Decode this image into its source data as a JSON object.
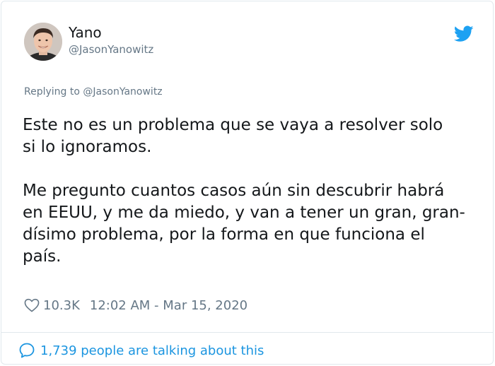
{
  "author": {
    "display_name": "Yano",
    "handle": "@JasonYanowitz"
  },
  "reply": {
    "prefix": "Replying to ",
    "handle": "@JasonYanowitz"
  },
  "tweet": {
    "paragraphs": [
      "Este no es un problema que se vaya a resolver solo\nsi lo ignoramos.",
      "Me pregunto cuantos casos aún sin descubrir habrá\nen EEUU, y me da miedo, y van a tener un gran, gran-\ndísimo problema, por la forma en que funciona el\npaís."
    ]
  },
  "meta": {
    "likes": "10.3K",
    "timestamp": "12:02 AM - Mar 15, 2020"
  },
  "footer": {
    "talking": "1,739 people are talking about this"
  },
  "icons": {
    "brand": "twitter-bird-icon",
    "like": "heart-icon",
    "conversation": "speech-bubble-icon"
  },
  "colors": {
    "brand": "#1da1f2",
    "link": "#1b95e0",
    "muted": "#657786",
    "text": "#14171a"
  }
}
